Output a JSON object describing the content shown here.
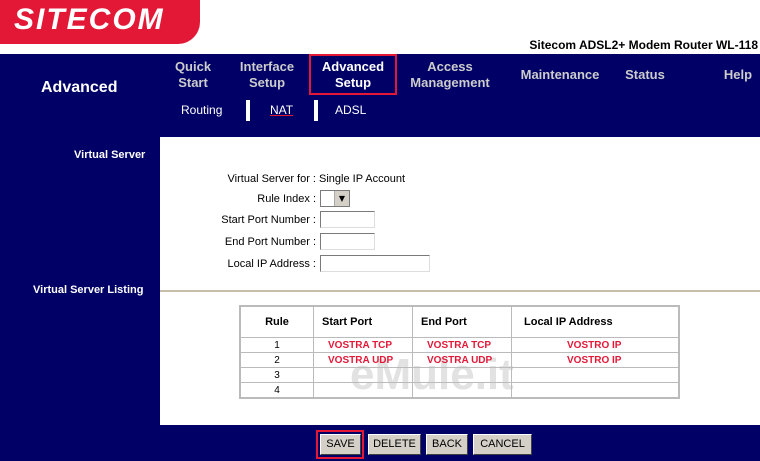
{
  "header": {
    "logo_text": "SITECOM",
    "model": "Sitecom ADSL2+ Modem Router WL-118"
  },
  "section_title": "Advanced",
  "nav": {
    "quick_start": [
      "Quick",
      "Start"
    ],
    "interface_setup": [
      "Interface",
      "Setup"
    ],
    "advanced_setup": [
      "Advanced",
      "Setup"
    ],
    "access_management": [
      "Access",
      "Management"
    ],
    "maintenance": "Maintenance",
    "status": "Status",
    "help": "Help"
  },
  "subtabs": {
    "routing": "Routing",
    "nat": "NAT",
    "adsl": "ADSL"
  },
  "left": {
    "virtual_server": "Virtual Server",
    "virtual_server_listing": "Virtual Server Listing"
  },
  "form": {
    "vs_for_label": "Virtual Server for :",
    "vs_for_value": "Single IP Account",
    "rule_index_label": "Rule Index :",
    "start_port_label": "Start Port Number :",
    "end_port_label": "End Port Number :",
    "local_ip_label": "Local IP Address :",
    "start_port_value": "",
    "end_port_value": "",
    "local_ip_value": ""
  },
  "table": {
    "headers": {
      "rule": "Rule",
      "start": "Start Port",
      "end": "End Port",
      "ip": "Local IP Address"
    },
    "rows": [
      {
        "rule": "1",
        "start": "VOSTRA TCP",
        "end": "VOSTRA TCP",
        "ip": "VOSTRO IP"
      },
      {
        "rule": "2",
        "start": "VOSTRA UDP",
        "end": "VOSTRA UDP",
        "ip": "VOSTRO IP"
      },
      {
        "rule": "3",
        "start": "",
        "end": "",
        "ip": ""
      },
      {
        "rule": "4",
        "start": "",
        "end": "",
        "ip": ""
      }
    ]
  },
  "watermark": "eMule.it",
  "buttons": {
    "save": "SAVE",
    "delete": "DELETE",
    "back": "BACK",
    "cancel": "CANCEL"
  },
  "colors": {
    "navy": "#000066",
    "accent": "#e31837"
  }
}
